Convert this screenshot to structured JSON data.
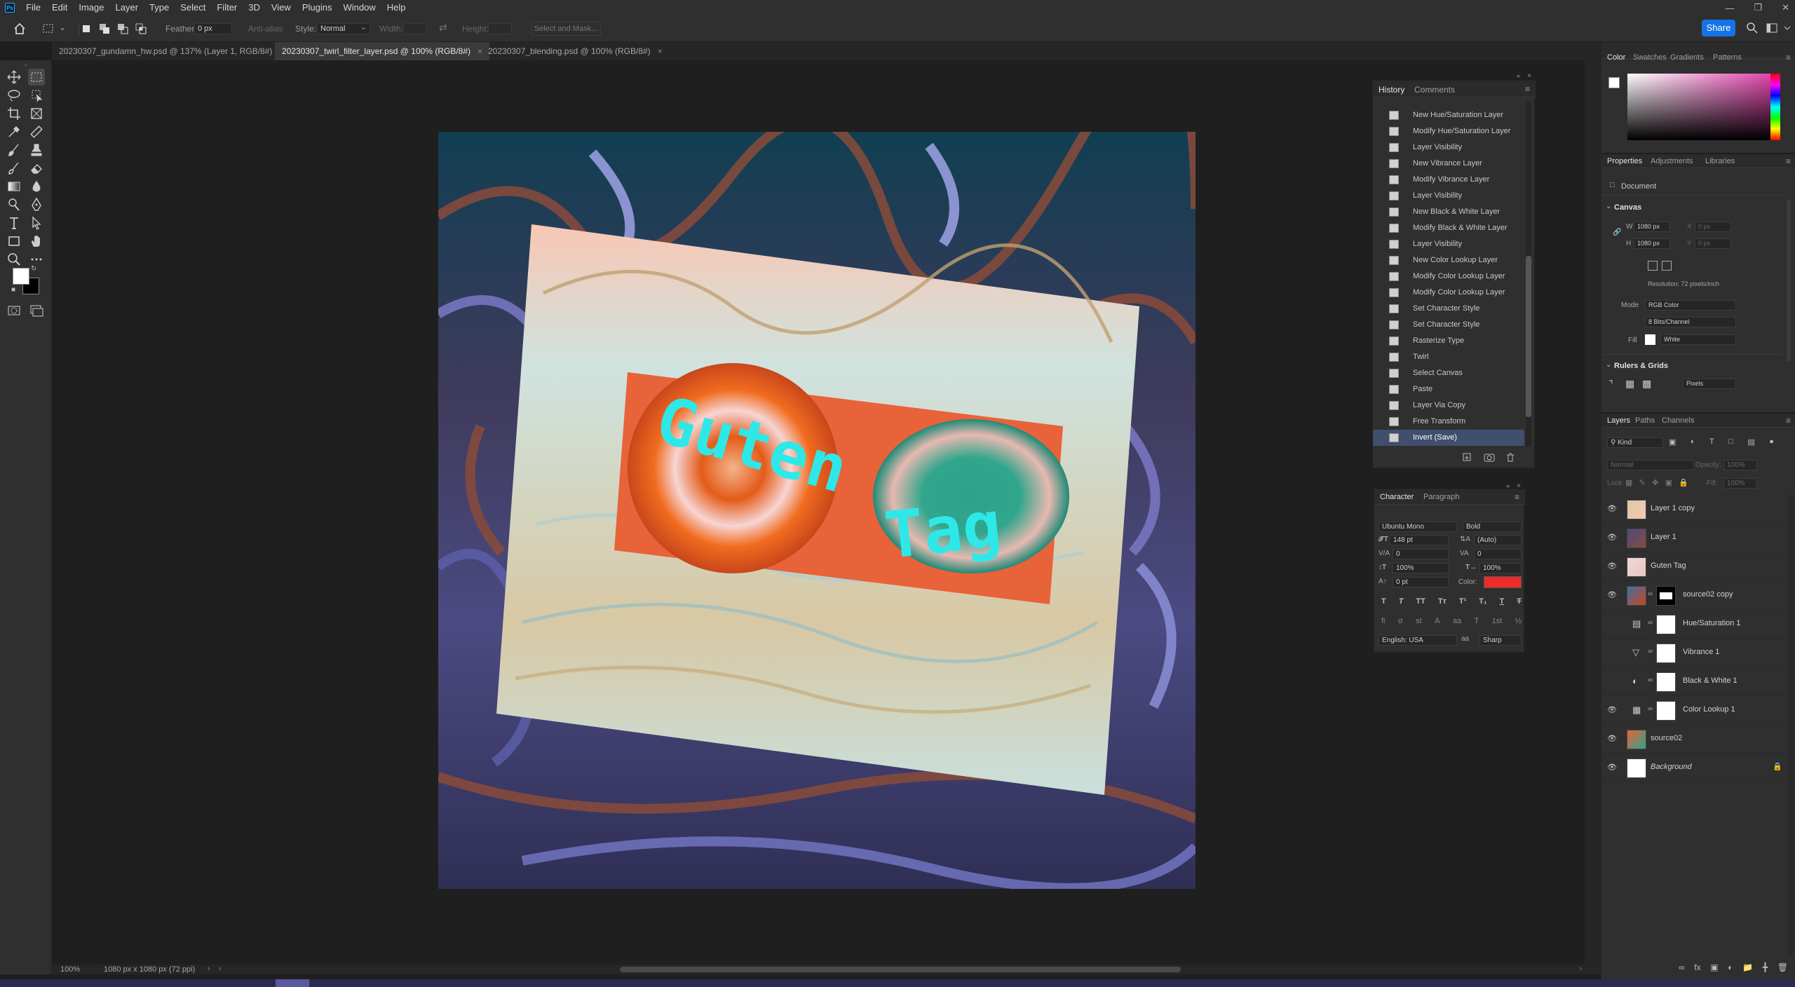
{
  "menu": [
    "File",
    "Edit",
    "Image",
    "Layer",
    "Type",
    "Select",
    "Filter",
    "3D",
    "View",
    "Plugins",
    "Window",
    "Help"
  ],
  "options": {
    "feather_label": "Feather:",
    "feather_value": "0 px",
    "antialias_label": "Anti-alias",
    "style_label": "Style:",
    "style_value": "Normal",
    "width_label": "Width:",
    "height_label": "Height:",
    "select_mask": "Select and Mask...",
    "share": "Share"
  },
  "tabs": [
    {
      "label": "20230307_gundamn_hw.psd @ 137% (Layer 1, RGB/8#)",
      "active": false
    },
    {
      "label": "20230307_twirl_filter_layer.psd @ 100% (RGB/8#)",
      "active": true
    },
    {
      "label": "20230307_blending.psd @ 100% (RGB/8#)",
      "active": false
    }
  ],
  "canvas": {
    "text_line1": "Guten",
    "text_line2": "Tag"
  },
  "status": {
    "zoom": "100%",
    "info": "1080 px x 1080 px (72 ppi)"
  },
  "history": {
    "tabs": [
      "History",
      "Comments"
    ],
    "items": [
      "New Hue/Saturation Layer",
      "Modify Hue/Saturation Layer",
      "Layer Visibility",
      "New Vibrance Layer",
      "Modify Vibrance Layer",
      "Layer Visibility",
      "New Black & White Layer",
      "Modify Black & White Layer",
      "Layer Visibility",
      "New Color Lookup Layer",
      "Modify Color Lookup Layer",
      "Modify Color Lookup Layer",
      "Set Character Style",
      "Set Character Style",
      "Rasterize Type",
      "Twirl",
      "Select Canvas",
      "Paste",
      "Layer Via Copy",
      "Free Transform",
      "Invert (Save)"
    ],
    "selected_index": 20
  },
  "character": {
    "tabs": [
      "Character",
      "Paragraph"
    ],
    "font_family": "Ubuntu Mono",
    "font_style": "Bold",
    "size": "148 pt",
    "leading": "(Auto)",
    "kerning": "0",
    "tracking": "0",
    "vscale": "100%",
    "hscale": "100%",
    "baseline": "0 pt",
    "color_label": "Color:",
    "color": "#ee2a2a",
    "language": "English: USA",
    "aa": "Sharp",
    "aa_glyph": "aa"
  },
  "color_panel": {
    "tabs": [
      "Color",
      "Swatches",
      "Gradients",
      "Patterns"
    ]
  },
  "properties": {
    "tabs": [
      "Properties",
      "Adjustments",
      "Libraries"
    ],
    "doc_label": "Document",
    "canvas_label": "Canvas",
    "w_label": "W",
    "w_value": "1080 px",
    "h_label": "H",
    "h_value": "1080 px",
    "x_label": "X",
    "x_value": "0 px",
    "y_label": "Y",
    "y_value": "0 px",
    "resolution": "Resolution: 72 pixels/inch",
    "mode_label": "Mode",
    "mode_value": "RGB Color",
    "depth_value": "8 Bits/Channel",
    "fill_label": "Fill",
    "fill_value": "White",
    "rulers_label": "Rulers & Grids",
    "units_value": "Pixels"
  },
  "layers": {
    "tabs": [
      "Layers",
      "Paths",
      "Channels"
    ],
    "kind": "Kind",
    "blend": "Normal",
    "opacity_label": "Opacity:",
    "opacity": "100%",
    "lock_label": "Lock:",
    "fill_label": "Fill:",
    "fill": "100%",
    "items": [
      {
        "name": "Layer 1 copy",
        "visible": true
      },
      {
        "name": "Layer 1",
        "visible": true
      },
      {
        "name": "Guten Tag",
        "visible": true
      },
      {
        "name": "source02 copy",
        "visible": true
      },
      {
        "name": "Hue/Saturation 1",
        "visible": false
      },
      {
        "name": "Vibrance 1",
        "visible": false
      },
      {
        "name": "Black & White 1",
        "visible": false
      },
      {
        "name": "Color Lookup 1",
        "visible": true
      },
      {
        "name": "source02",
        "visible": true
      },
      {
        "name": "Background",
        "visible": true
      }
    ]
  }
}
